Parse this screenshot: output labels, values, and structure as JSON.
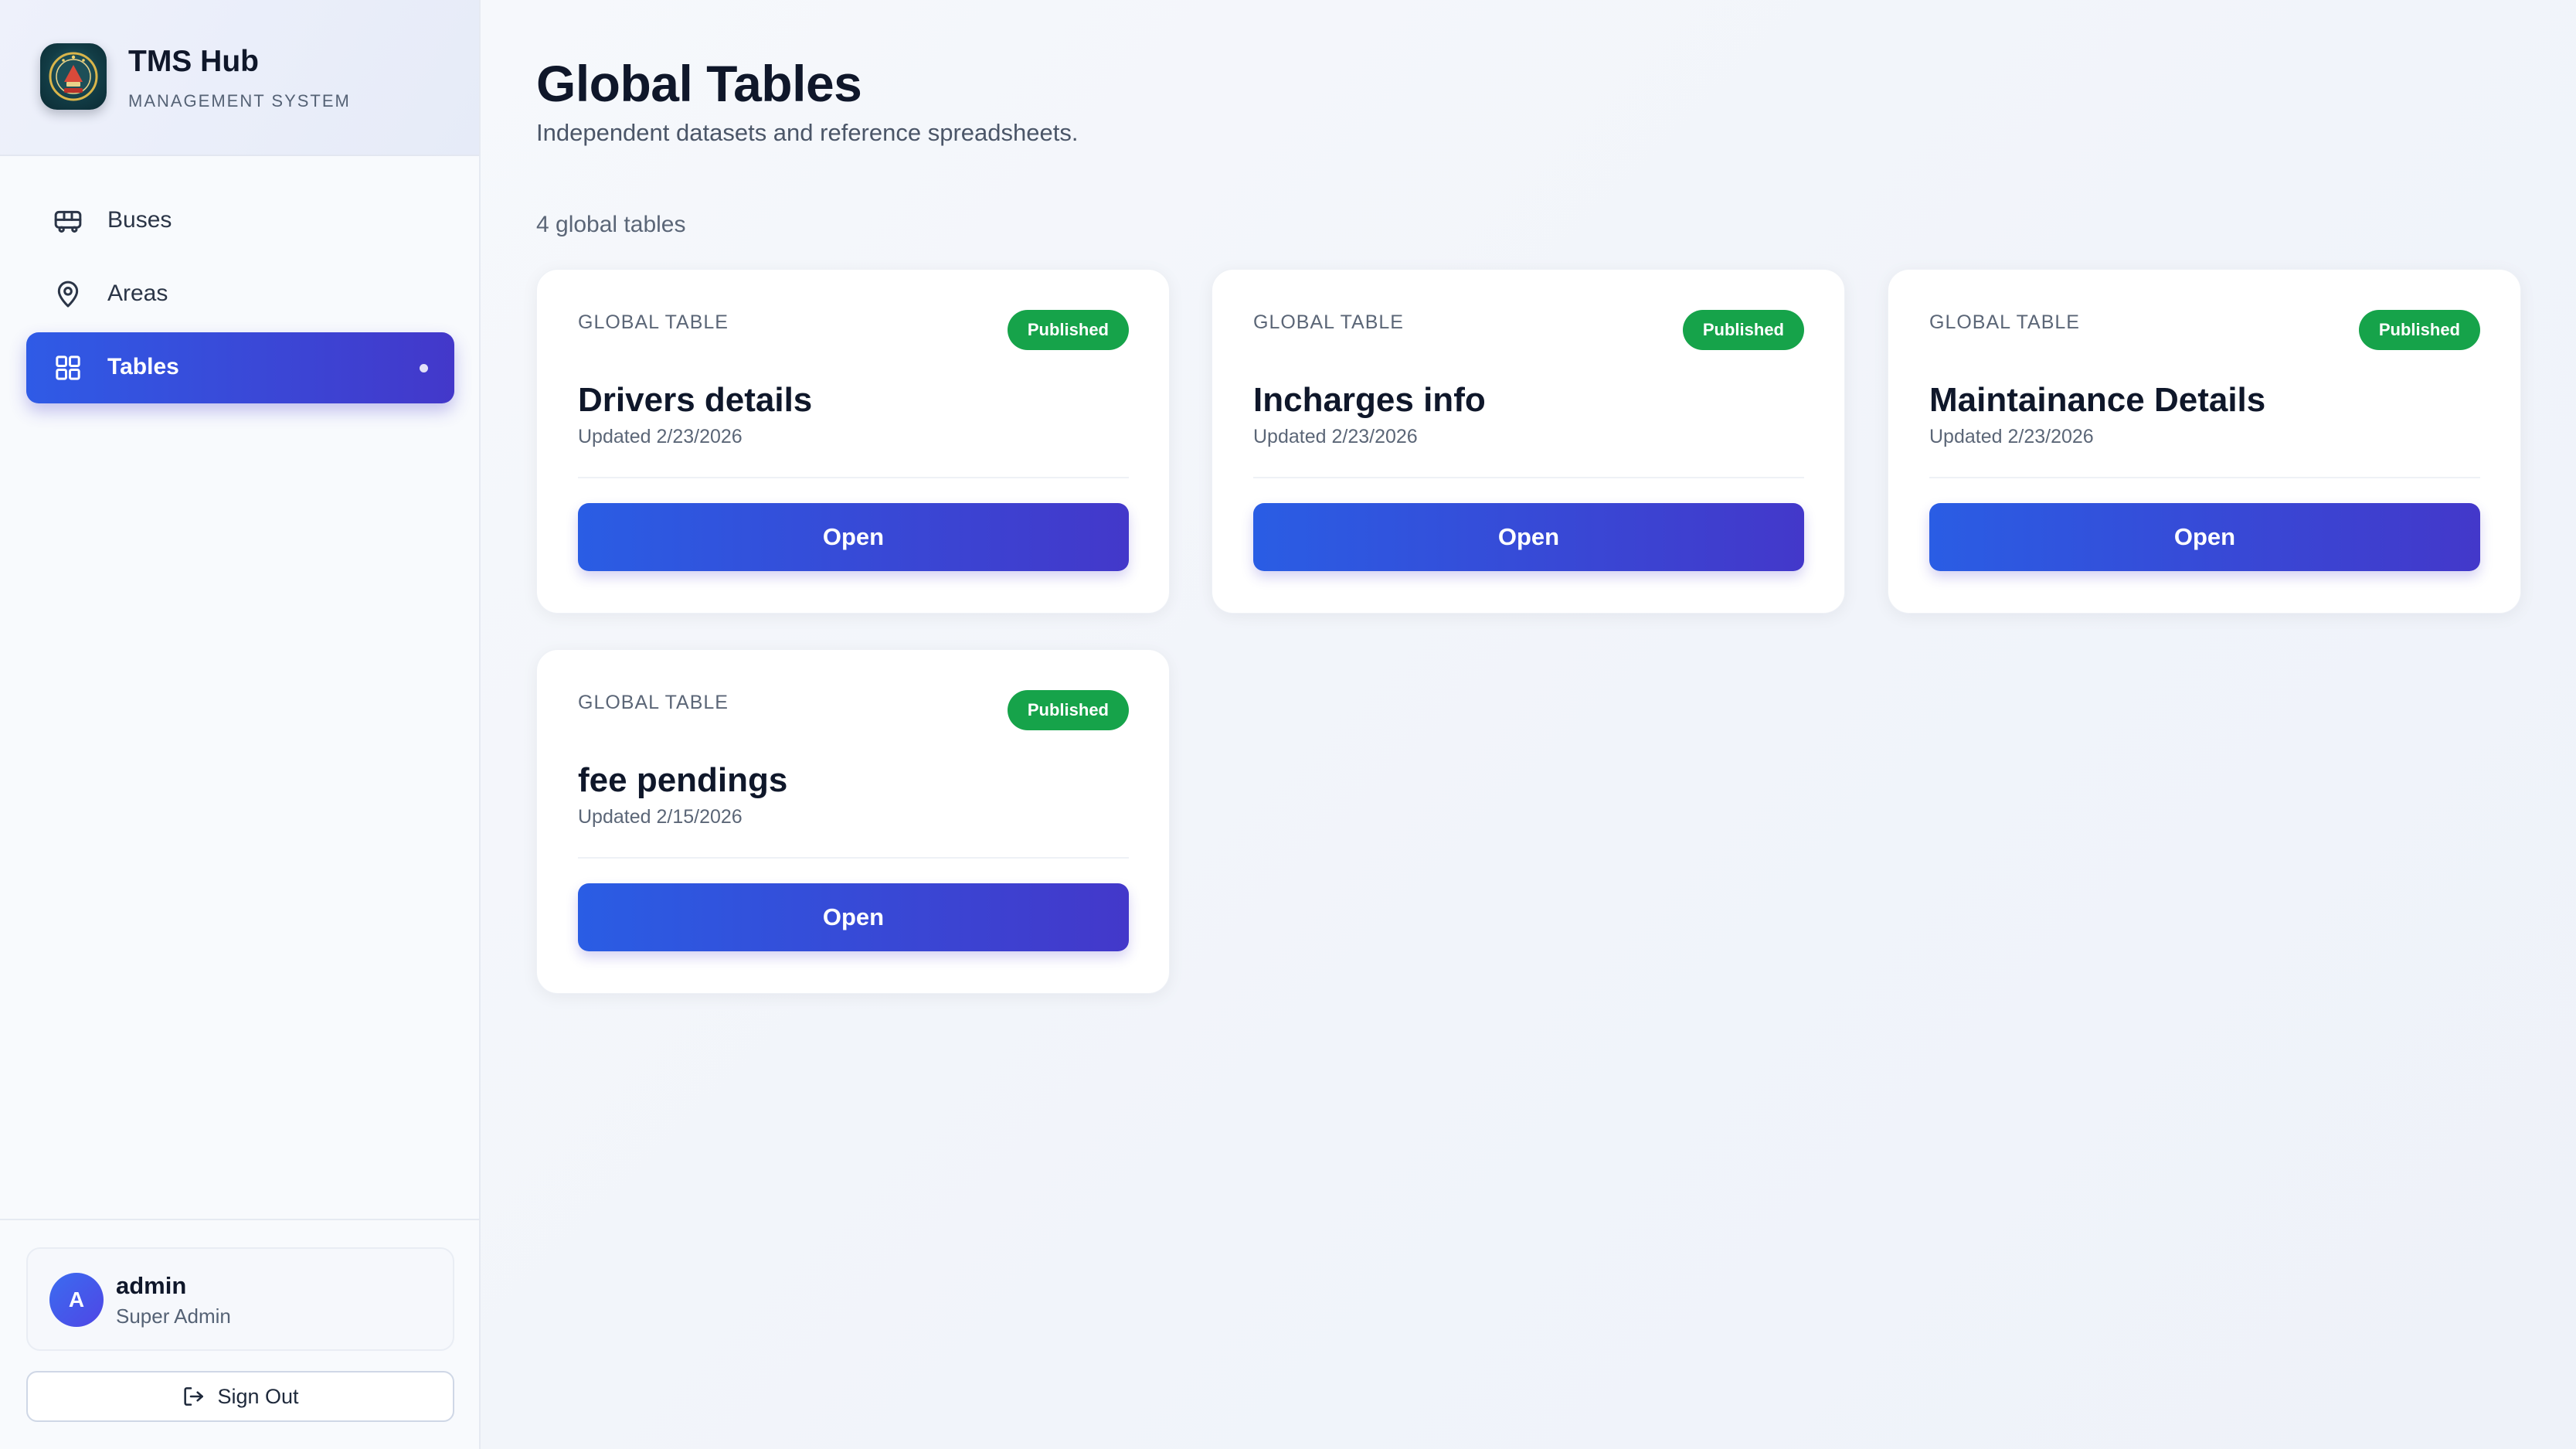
{
  "brand": {
    "title": "TMS Hub",
    "subtitle": "MANAGEMENT SYSTEM",
    "logo_icon": "emblem-logo"
  },
  "sidebar": {
    "items": [
      {
        "label": "Buses",
        "icon": "bus-icon",
        "active": false
      },
      {
        "label": "Areas",
        "icon": "map-pin-icon",
        "active": false
      },
      {
        "label": "Tables",
        "icon": "grid-icon",
        "active": true
      }
    ],
    "user": {
      "initial": "A",
      "name": "admin",
      "role": "Super Admin"
    },
    "sign_out_label": "Sign Out"
  },
  "main": {
    "title": "Global Tables",
    "subtitle": "Independent datasets and reference spreadsheets.",
    "count_text": "4 global tables",
    "cards": [
      {
        "kicker": "GLOBAL TABLE",
        "badge": "Published",
        "title": "Drivers details",
        "updated": "Updated 2/23/2026",
        "button": "Open"
      },
      {
        "kicker": "GLOBAL TABLE",
        "badge": "Published",
        "title": "Incharges info",
        "updated": "Updated 2/23/2026",
        "button": "Open"
      },
      {
        "kicker": "GLOBAL TABLE",
        "badge": "Published",
        "title": "Maintainance Details",
        "updated": "Updated 2/23/2026",
        "button": "Open"
      },
      {
        "kicker": "GLOBAL TABLE",
        "badge": "Published",
        "title": "fee pendings",
        "updated": "Updated 2/15/2026",
        "button": "Open"
      }
    ]
  },
  "colors": {
    "accent_start": "#2a5de4",
    "accent_end": "#4338ca",
    "published_green": "#16a34a",
    "text_primary": "#0f172a",
    "text_muted": "#5b6677"
  }
}
